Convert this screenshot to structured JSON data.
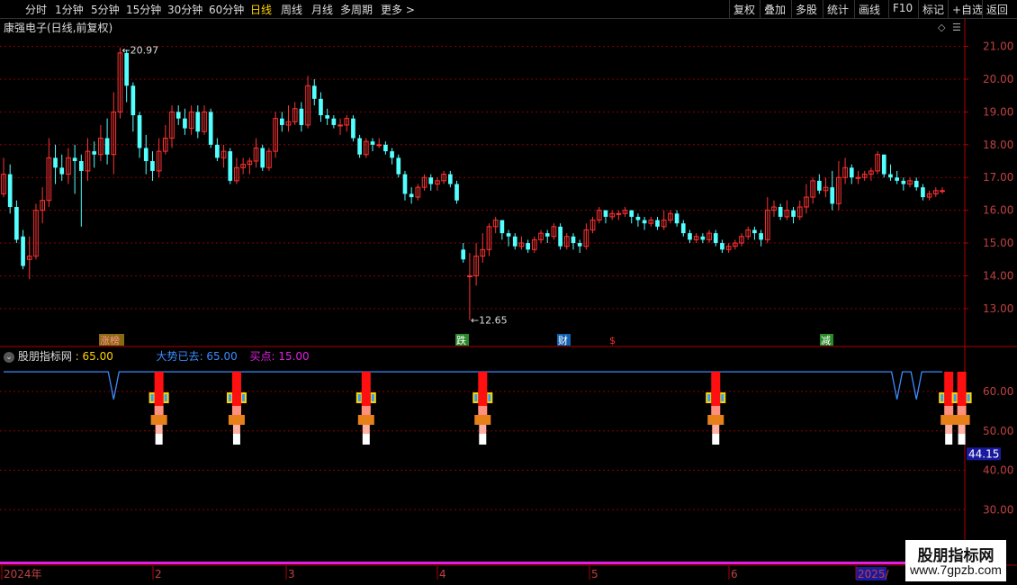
{
  "colors": {
    "up": "#ff3232",
    "down": "#54ffff",
    "grid": "#8b0000",
    "axis": "#b00000",
    "signal": "#3c8cff",
    "accent": "#ffd400",
    "magenta": "#e020e0"
  },
  "toolbar": {
    "periods": [
      "分时",
      "1分钟",
      "5分钟",
      "15分钟",
      "30分钟",
      "60分钟",
      "日线",
      "周线",
      "月线",
      "多周期",
      "更多 >"
    ],
    "active_period": "日线",
    "tools": [
      "复权",
      "叠加",
      "多股",
      "统计",
      "画线",
      "F10",
      "标记",
      "+自选",
      "返回"
    ]
  },
  "main": {
    "title": "康强电子(日线,前复权)",
    "high_label": "20.97",
    "low_label": "12.65",
    "y_ticks": [
      "21.00",
      "20.00",
      "19.00",
      "18.00",
      "17.00",
      "16.00",
      "15.00",
      "14.00",
      "13.00"
    ],
    "event_markers": [
      {
        "text": "涨榜",
        "color": "#ff9090",
        "bg": "#8a6a10"
      },
      {
        "text": "跌",
        "color": "#ffffff",
        "bg": "#2a8a2a"
      },
      {
        "text": "财",
        "color": "#ffffff",
        "bg": "#1060b0"
      },
      {
        "text": "$",
        "color": "#ff3030",
        "bg": ""
      },
      {
        "text": "减",
        "color": "#ffffff",
        "bg": "#2a8a2a"
      }
    ]
  },
  "indicator": {
    "name": "股朋指标网",
    "value": "65.00",
    "line1_label": "大势已去",
    "line1_value": "65.00",
    "line2_label": "买点",
    "line2_value": "15.00",
    "y_ticks": [
      "60.00",
      "50.00",
      "40.00",
      "30.00"
    ],
    "current_value_label": "44.15"
  },
  "time_axis": {
    "labels": [
      "2024年",
      "2",
      "3",
      "4",
      "5",
      "6",
      "2025/"
    ]
  },
  "watermark": {
    "line1": "股朋指标网",
    "line2": "www.7gpzb.com"
  },
  "chart_data": {
    "type": "candlestick",
    "title": "康强电子(日线,前复权)",
    "price_range": [
      12.2,
      21.4
    ],
    "high": 20.97,
    "low": 12.65,
    "candles": [
      [
        16.5,
        17.1,
        16.4,
        17.6
      ],
      [
        17.1,
        16.1,
        15.9,
        17.4
      ],
      [
        16.1,
        15.1,
        15.0,
        16.3
      ],
      [
        15.2,
        14.3,
        14.2,
        15.4
      ],
      [
        14.5,
        14.6,
        13.9,
        15.2
      ],
      [
        14.6,
        16.0,
        14.5,
        16.2
      ],
      [
        16.0,
        16.3,
        15.6,
        16.7
      ],
      [
        16.3,
        17.6,
        16.1,
        18.2
      ],
      [
        17.6,
        17.3,
        16.8,
        18.0
      ],
      [
        17.3,
        17.1,
        16.9,
        17.7
      ],
      [
        17.1,
        17.6,
        16.8,
        17.9
      ],
      [
        17.6,
        17.5,
        16.5,
        18.0
      ],
      [
        17.5,
        17.2,
        15.5,
        17.7
      ],
      [
        17.2,
        17.8,
        16.9,
        18.2
      ],
      [
        17.8,
        17.7,
        17.3,
        18.1
      ],
      [
        17.7,
        18.2,
        17.5,
        18.6
      ],
      [
        18.2,
        17.7,
        17.4,
        18.8
      ],
      [
        17.7,
        19.0,
        17.1,
        19.6
      ],
      [
        19.0,
        20.8,
        18.8,
        20.97
      ],
      [
        20.8,
        19.8,
        19.3,
        20.9
      ],
      [
        19.8,
        18.9,
        18.4,
        19.9
      ],
      [
        18.9,
        17.9,
        17.6,
        19.0
      ],
      [
        17.9,
        17.5,
        17.1,
        18.3
      ],
      [
        17.5,
        17.2,
        16.9,
        17.8
      ],
      [
        17.2,
        17.8,
        17.0,
        18.2
      ],
      [
        17.8,
        18.2,
        17.7,
        18.6
      ],
      [
        18.2,
        19.0,
        17.9,
        19.2
      ],
      [
        19.0,
        18.8,
        18.6,
        19.2
      ],
      [
        18.8,
        18.5,
        18.3,
        19.1
      ],
      [
        18.5,
        19.0,
        18.3,
        19.2
      ],
      [
        19.0,
        18.4,
        18.2,
        19.2
      ],
      [
        18.4,
        19.0,
        18.3,
        19.2
      ],
      [
        19.0,
        18.0,
        17.9,
        19.1
      ],
      [
        18.0,
        17.6,
        17.5,
        18.2
      ],
      [
        17.6,
        17.8,
        17.3,
        18.0
      ],
      [
        17.8,
        16.9,
        16.8,
        17.9
      ],
      [
        16.9,
        17.3,
        16.8,
        17.6
      ],
      [
        17.3,
        17.4,
        17.1,
        17.6
      ],
      [
        17.4,
        17.5,
        17.1,
        17.6
      ],
      [
        17.5,
        17.9,
        17.3,
        18.2
      ],
      [
        17.9,
        17.3,
        17.2,
        18.0
      ],
      [
        17.3,
        17.8,
        17.2,
        17.9
      ],
      [
        17.8,
        18.8,
        17.6,
        19.0
      ],
      [
        18.8,
        18.6,
        18.4,
        19.0
      ],
      [
        18.6,
        18.7,
        18.4,
        19.2
      ],
      [
        18.7,
        19.1,
        18.6,
        19.3
      ],
      [
        19.1,
        18.6,
        18.4,
        19.3
      ],
      [
        18.6,
        19.8,
        18.5,
        20.1
      ],
      [
        19.8,
        19.4,
        19.2,
        20.0
      ],
      [
        19.4,
        18.9,
        18.7,
        19.6
      ],
      [
        18.9,
        18.8,
        18.6,
        19.1
      ],
      [
        18.8,
        18.6,
        18.5,
        18.9
      ],
      [
        18.6,
        18.6,
        18.3,
        18.8
      ],
      [
        18.6,
        18.8,
        18.4,
        18.9
      ],
      [
        18.8,
        18.2,
        18.1,
        18.9
      ],
      [
        18.2,
        17.7,
        17.6,
        18.3
      ],
      [
        17.7,
        18.1,
        17.6,
        18.2
      ],
      [
        18.1,
        18.0,
        17.8,
        18.2
      ],
      [
        18.0,
        18.0,
        17.9,
        18.2
      ],
      [
        18.0,
        17.8,
        17.7,
        18.1
      ],
      [
        17.8,
        17.6,
        17.4,
        17.9
      ],
      [
        17.6,
        17.1,
        17.0,
        17.7
      ],
      [
        17.1,
        16.5,
        16.3,
        17.2
      ],
      [
        16.5,
        16.4,
        16.2,
        16.7
      ],
      [
        16.4,
        16.7,
        16.3,
        16.8
      ],
      [
        16.7,
        17.0,
        16.6,
        17.1
      ],
      [
        17.0,
        16.8,
        16.6,
        17.1
      ],
      [
        16.8,
        16.9,
        16.6,
        17.0
      ],
      [
        16.9,
        17.1,
        16.8,
        17.2
      ],
      [
        17.1,
        16.8,
        16.7,
        17.2
      ],
      [
        16.8,
        16.3,
        16.2,
        16.9
      ],
      [
        14.8,
        14.5,
        14.4,
        15.0
      ],
      [
        14.0,
        14.0,
        12.65,
        14.7
      ],
      [
        14.0,
        14.6,
        13.7,
        15.0
      ],
      [
        14.6,
        14.8,
        14.4,
        15.3
      ],
      [
        14.8,
        15.5,
        14.6,
        15.6
      ],
      [
        15.5,
        15.7,
        15.3,
        15.8
      ],
      [
        15.7,
        15.3,
        15.1,
        15.7
      ],
      [
        15.3,
        15.2,
        14.9,
        15.4
      ],
      [
        15.2,
        14.9,
        14.8,
        15.3
      ],
      [
        14.9,
        15.0,
        14.8,
        15.2
      ],
      [
        15.0,
        14.8,
        14.7,
        15.1
      ],
      [
        14.8,
        15.1,
        14.7,
        15.2
      ],
      [
        15.1,
        15.3,
        15.0,
        15.4
      ],
      [
        15.3,
        15.2,
        15.0,
        15.4
      ],
      [
        15.2,
        15.5,
        15.1,
        15.6
      ],
      [
        15.5,
        14.9,
        14.8,
        15.6
      ],
      [
        14.9,
        15.2,
        14.8,
        15.3
      ],
      [
        15.2,
        15.0,
        14.8,
        15.3
      ],
      [
        15.0,
        14.9,
        14.7,
        15.1
      ],
      [
        14.9,
        15.4,
        14.8,
        15.6
      ],
      [
        15.4,
        15.7,
        15.3,
        15.8
      ],
      [
        15.7,
        16.0,
        15.6,
        16.1
      ],
      [
        16.0,
        15.8,
        15.6,
        16.0
      ],
      [
        15.8,
        15.9,
        15.7,
        16.0
      ],
      [
        15.9,
        15.9,
        15.7,
        16.0
      ],
      [
        15.9,
        16.0,
        15.8,
        16.1
      ],
      [
        16.0,
        15.8,
        15.6,
        16.0
      ],
      [
        15.8,
        15.7,
        15.5,
        15.9
      ],
      [
        15.7,
        15.6,
        15.4,
        15.8
      ],
      [
        15.6,
        15.7,
        15.5,
        15.8
      ],
      [
        15.7,
        15.5,
        15.4,
        15.8
      ],
      [
        15.5,
        15.7,
        15.4,
        16.0
      ],
      [
        15.7,
        15.9,
        15.6,
        16.0
      ],
      [
        15.9,
        15.6,
        15.5,
        16.0
      ],
      [
        15.6,
        15.3,
        15.2,
        15.7
      ],
      [
        15.3,
        15.1,
        15.0,
        15.4
      ],
      [
        15.1,
        15.2,
        15.0,
        15.3
      ],
      [
        15.2,
        15.1,
        15.0,
        15.3
      ],
      [
        15.1,
        15.3,
        15.0,
        15.4
      ],
      [
        15.3,
        15.0,
        14.9,
        15.4
      ],
      [
        15.0,
        14.8,
        14.7,
        15.1
      ],
      [
        14.8,
        14.9,
        14.7,
        15.0
      ],
      [
        14.9,
        15.0,
        14.8,
        15.1
      ],
      [
        15.0,
        15.2,
        14.9,
        15.3
      ],
      [
        15.2,
        15.4,
        15.1,
        15.5
      ],
      [
        15.4,
        15.3,
        15.1,
        15.5
      ],
      [
        15.3,
        15.1,
        14.9,
        15.4
      ],
      [
        15.1,
        16.0,
        15.0,
        16.4
      ],
      [
        16.0,
        16.1,
        15.8,
        16.3
      ],
      [
        16.1,
        15.8,
        15.7,
        16.2
      ],
      [
        15.8,
        16.0,
        15.7,
        16.3
      ],
      [
        16.0,
        15.8,
        15.6,
        16.1
      ],
      [
        15.8,
        16.1,
        15.7,
        16.3
      ],
      [
        16.1,
        16.4,
        15.9,
        16.8
      ],
      [
        16.4,
        16.9,
        16.2,
        17.0
      ],
      [
        16.9,
        16.6,
        16.5,
        17.1
      ],
      [
        16.6,
        16.7,
        16.4,
        17.0
      ],
      [
        16.7,
        16.2,
        16.0,
        17.2
      ],
      [
        16.2,
        17.0,
        16.0,
        17.5
      ],
      [
        17.0,
        17.3,
        16.8,
        17.6
      ],
      [
        17.3,
        17.0,
        16.8,
        17.4
      ],
      [
        17.0,
        17.0,
        16.8,
        17.2
      ],
      [
        17.0,
        17.1,
        16.9,
        17.2
      ],
      [
        17.1,
        17.2,
        16.9,
        17.3
      ],
      [
        17.2,
        17.7,
        17.1,
        17.8
      ],
      [
        17.7,
        17.1,
        17.0,
        17.7
      ],
      [
        17.1,
        17.0,
        16.9,
        17.4
      ],
      [
        17.0,
        16.9,
        16.8,
        17.2
      ],
      [
        16.9,
        16.8,
        16.6,
        17.0
      ],
      [
        16.8,
        16.9,
        16.7,
        17.0
      ],
      [
        16.9,
        16.7,
        16.6,
        17.0
      ],
      [
        16.7,
        16.4,
        16.3,
        16.8
      ],
      [
        16.4,
        16.5,
        16.3,
        16.6
      ],
      [
        16.5,
        16.6,
        16.4,
        16.7
      ],
      [
        16.6,
        16.6,
        16.5,
        16.7
      ]
    ],
    "indicator_line_dips_at_candle_index": [
      17,
      138,
      141
    ],
    "buy_signal_candle_index": [
      24,
      36,
      56,
      74,
      110,
      146,
      148
    ]
  }
}
